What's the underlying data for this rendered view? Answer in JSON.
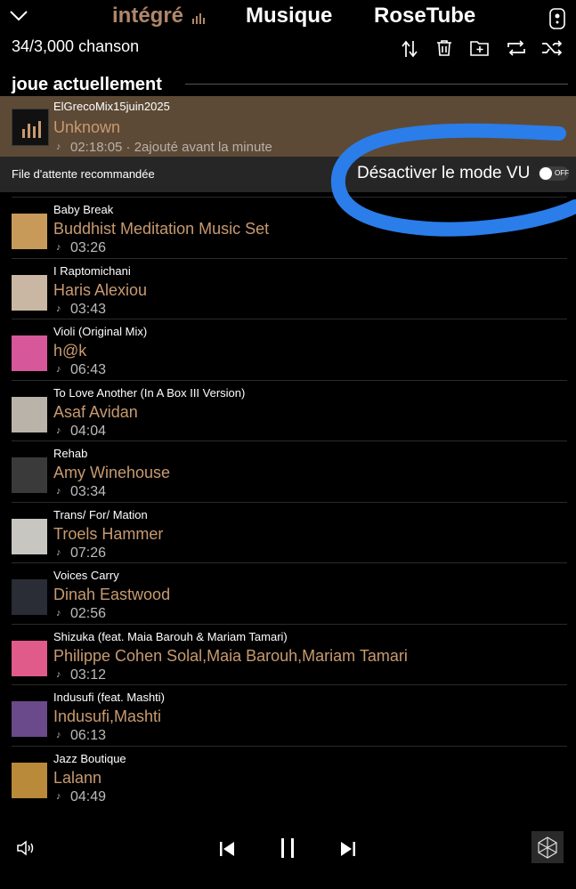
{
  "header": {
    "tabs": [
      {
        "label": "intégré",
        "active": true
      },
      {
        "label": "Musique",
        "active": false
      },
      {
        "label": "RoseTube",
        "active": false
      }
    ],
    "count": "34/3,000 chanson",
    "icons": [
      "chevron-down-icon",
      "remote-icon",
      "sort-icon",
      "trash-icon",
      "add-to-folder-icon",
      "repeat-icon",
      "shuffle-icon"
    ]
  },
  "now_playing": {
    "section_title": "joue actuellement",
    "album": "ElGrecoMix15juin2025",
    "artist": "Unknown",
    "meta": "02:18:05 · 2ajouté avant la minute"
  },
  "recommended": {
    "label": "File d'attente recommandée",
    "vu_label": "Désactiver le mode VU",
    "toggle_text": "OFF"
  },
  "songs": [
    {
      "album": "Baby Break",
      "artist": "Buddhist Meditation Music Set",
      "duration": "03:26",
      "art_color": "#c89a5a"
    },
    {
      "album": "I Raptomichani",
      "artist": "Haris Alexiou",
      "duration": "03:43",
      "art_color": "#c9b7a3"
    },
    {
      "album": "Violi (Original Mix)",
      "artist": "h@k",
      "duration": "06:43",
      "art_color": "#d6589a"
    },
    {
      "album": "To Love Another (In A Box III Version)",
      "artist": "Asaf Avidan",
      "duration": "04:04",
      "art_color": "#b9b3aa"
    },
    {
      "album": "Rehab",
      "artist": "Amy Winehouse",
      "duration": "03:34",
      "art_color": "#3a3a3a"
    },
    {
      "album": "Trans/ For/ Mation",
      "artist": "Troels Hammer",
      "duration": "07:26",
      "art_color": "#c8c6c0"
    },
    {
      "album": "Voices Carry",
      "artist": "Dinah Eastwood",
      "duration": "02:56",
      "art_color": "#2a2d35"
    },
    {
      "album": "Shizuka (feat. Maia Barouh & Mariam Tamari)",
      "artist": "Philippe Cohen Solal,Maia Barouh,Mariam Tamari",
      "duration": "03:12",
      "art_color": "#e05a8a"
    },
    {
      "album": "Indusufi (feat. Mashti)",
      "artist": "Indusufi,Mashti",
      "duration": "06:13",
      "art_color": "#6a4a8a"
    },
    {
      "album": "Jazz Boutique",
      "artist": "Lalann",
      "duration": "04:49",
      "art_color": "#b88a3a"
    }
  ],
  "player": {
    "icons": [
      "volume-icon",
      "previous-icon",
      "pause-icon",
      "next-icon",
      "cast-icon"
    ]
  },
  "colors": {
    "accent": "#c89a70",
    "highlight": "#2b7de9",
    "now_playing_bg": "#5d4a36"
  }
}
